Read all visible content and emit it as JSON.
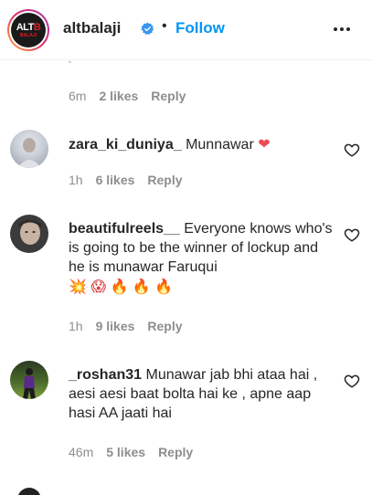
{
  "header": {
    "username": "altbalaji",
    "follow_label": "Follow",
    "separator": "•",
    "logo_text_white": "ALT",
    "logo_text_red": "B",
    "logo_sub": "BALAJI"
  },
  "colors": {
    "follow": "#0095f6",
    "verified": "#3897f0",
    "heart": "#ed4956",
    "muted": "#8e8e8e"
  },
  "top_comment": {
    "time": "6m",
    "likes": "2 likes",
    "reply": "Reply"
  },
  "comments": [
    {
      "username": "zara_ki_duniya_",
      "text": "Munnawar",
      "emoji": "❤",
      "time": "1h",
      "likes": "6 likes",
      "reply": "Reply"
    },
    {
      "username": "beautifulreels__",
      "text": "Everyone knows who's is going to be the winner of lockup and he is munawar Faruqui",
      "emoji": [
        "💥",
        "😱",
        "🔥",
        "🔥",
        "🔥"
      ],
      "time": "1h",
      "likes": "9 likes",
      "reply": "Reply"
    },
    {
      "username": "_roshan31",
      "text": "Munawar jab bhi ataa hai , aesi aesi baat bolta hai ke , apne aap hasi AA jaati hai",
      "time": "46m",
      "likes": "5 likes",
      "reply": "Reply"
    }
  ],
  "icons": {
    "verified": "verified-badge-icon",
    "more": "more-options-icon",
    "like": "heart-outline-icon"
  }
}
